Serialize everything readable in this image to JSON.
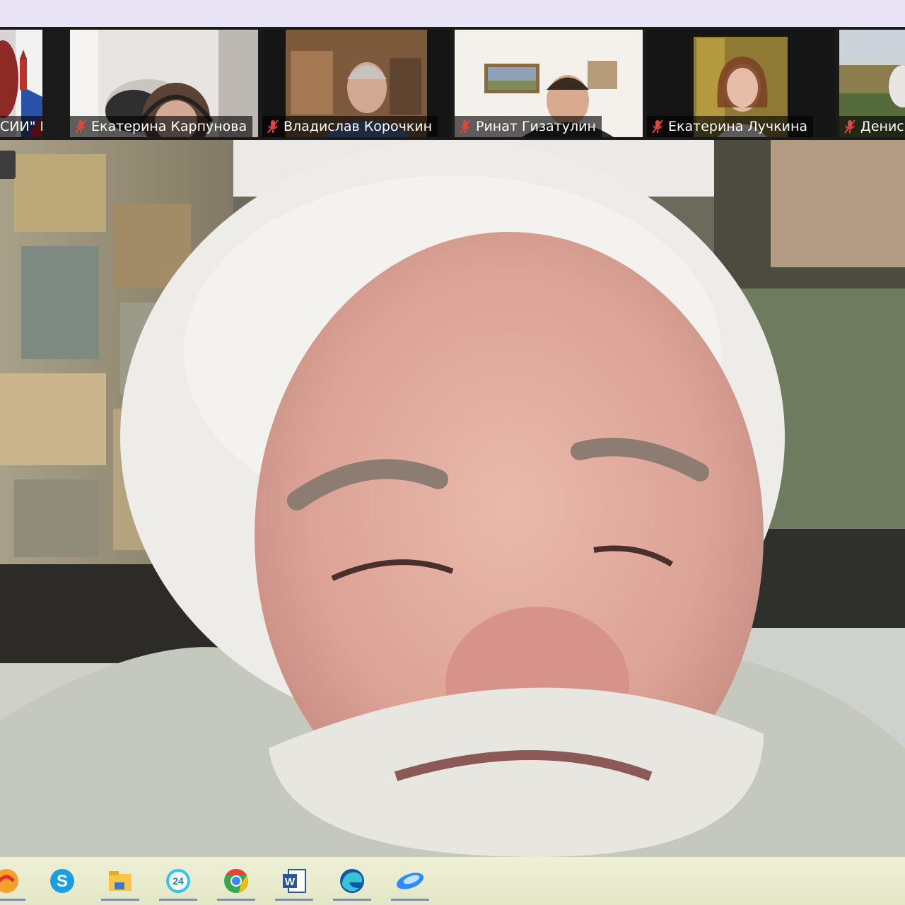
{
  "participants": [
    {
      "name": "СИИ\" Р..."
    },
    {
      "name": "Екатерина Карпунова"
    },
    {
      "name": "Владислав Корочкин"
    },
    {
      "name": "Ринат Гизатулин"
    },
    {
      "name": "Екатерина Лучкина"
    },
    {
      "name": "Денис"
    }
  ],
  "taskbar": {
    "apps": [
      {
        "icon": "browser-app-icon"
      },
      {
        "icon": "skype-icon",
        "label": "S"
      },
      {
        "icon": "file-explorer-icon"
      },
      {
        "icon": "bitrix24-icon",
        "label": "24"
      },
      {
        "icon": "chrome-icon"
      },
      {
        "icon": "word-icon",
        "label": "W"
      },
      {
        "icon": "edge-icon"
      },
      {
        "icon": "zoom-icon"
      }
    ]
  },
  "colors": {
    "background": "#ece6f7",
    "strip": "#1a1a1a",
    "mic_muted": "#e0463c",
    "taskbar": "#e8ebcc"
  }
}
